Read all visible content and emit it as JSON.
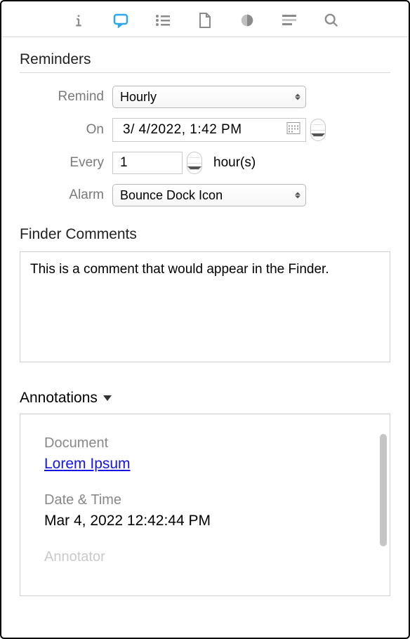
{
  "sections": {
    "reminders_title": "Reminders",
    "comments_title": "Finder Comments",
    "annotations_title": "Annotations"
  },
  "reminders": {
    "remind_label": "Remind",
    "remind_value": "Hourly",
    "on_label": "On",
    "on_value": "3/  4/2022,   1:42 PM",
    "every_label": "Every",
    "every_value": "1",
    "every_unit": "hour(s)",
    "alarm_label": "Alarm",
    "alarm_value": "Bounce Dock Icon"
  },
  "comments": {
    "text": "This is a comment that would appear in the Finder."
  },
  "annotations": {
    "document_label": "Document",
    "document_link": "Lorem Ipsum",
    "datetime_label": "Date & Time",
    "datetime_value": "Mar 4, 2022 12:42:44 PM",
    "annotator_label": "Annotator"
  }
}
